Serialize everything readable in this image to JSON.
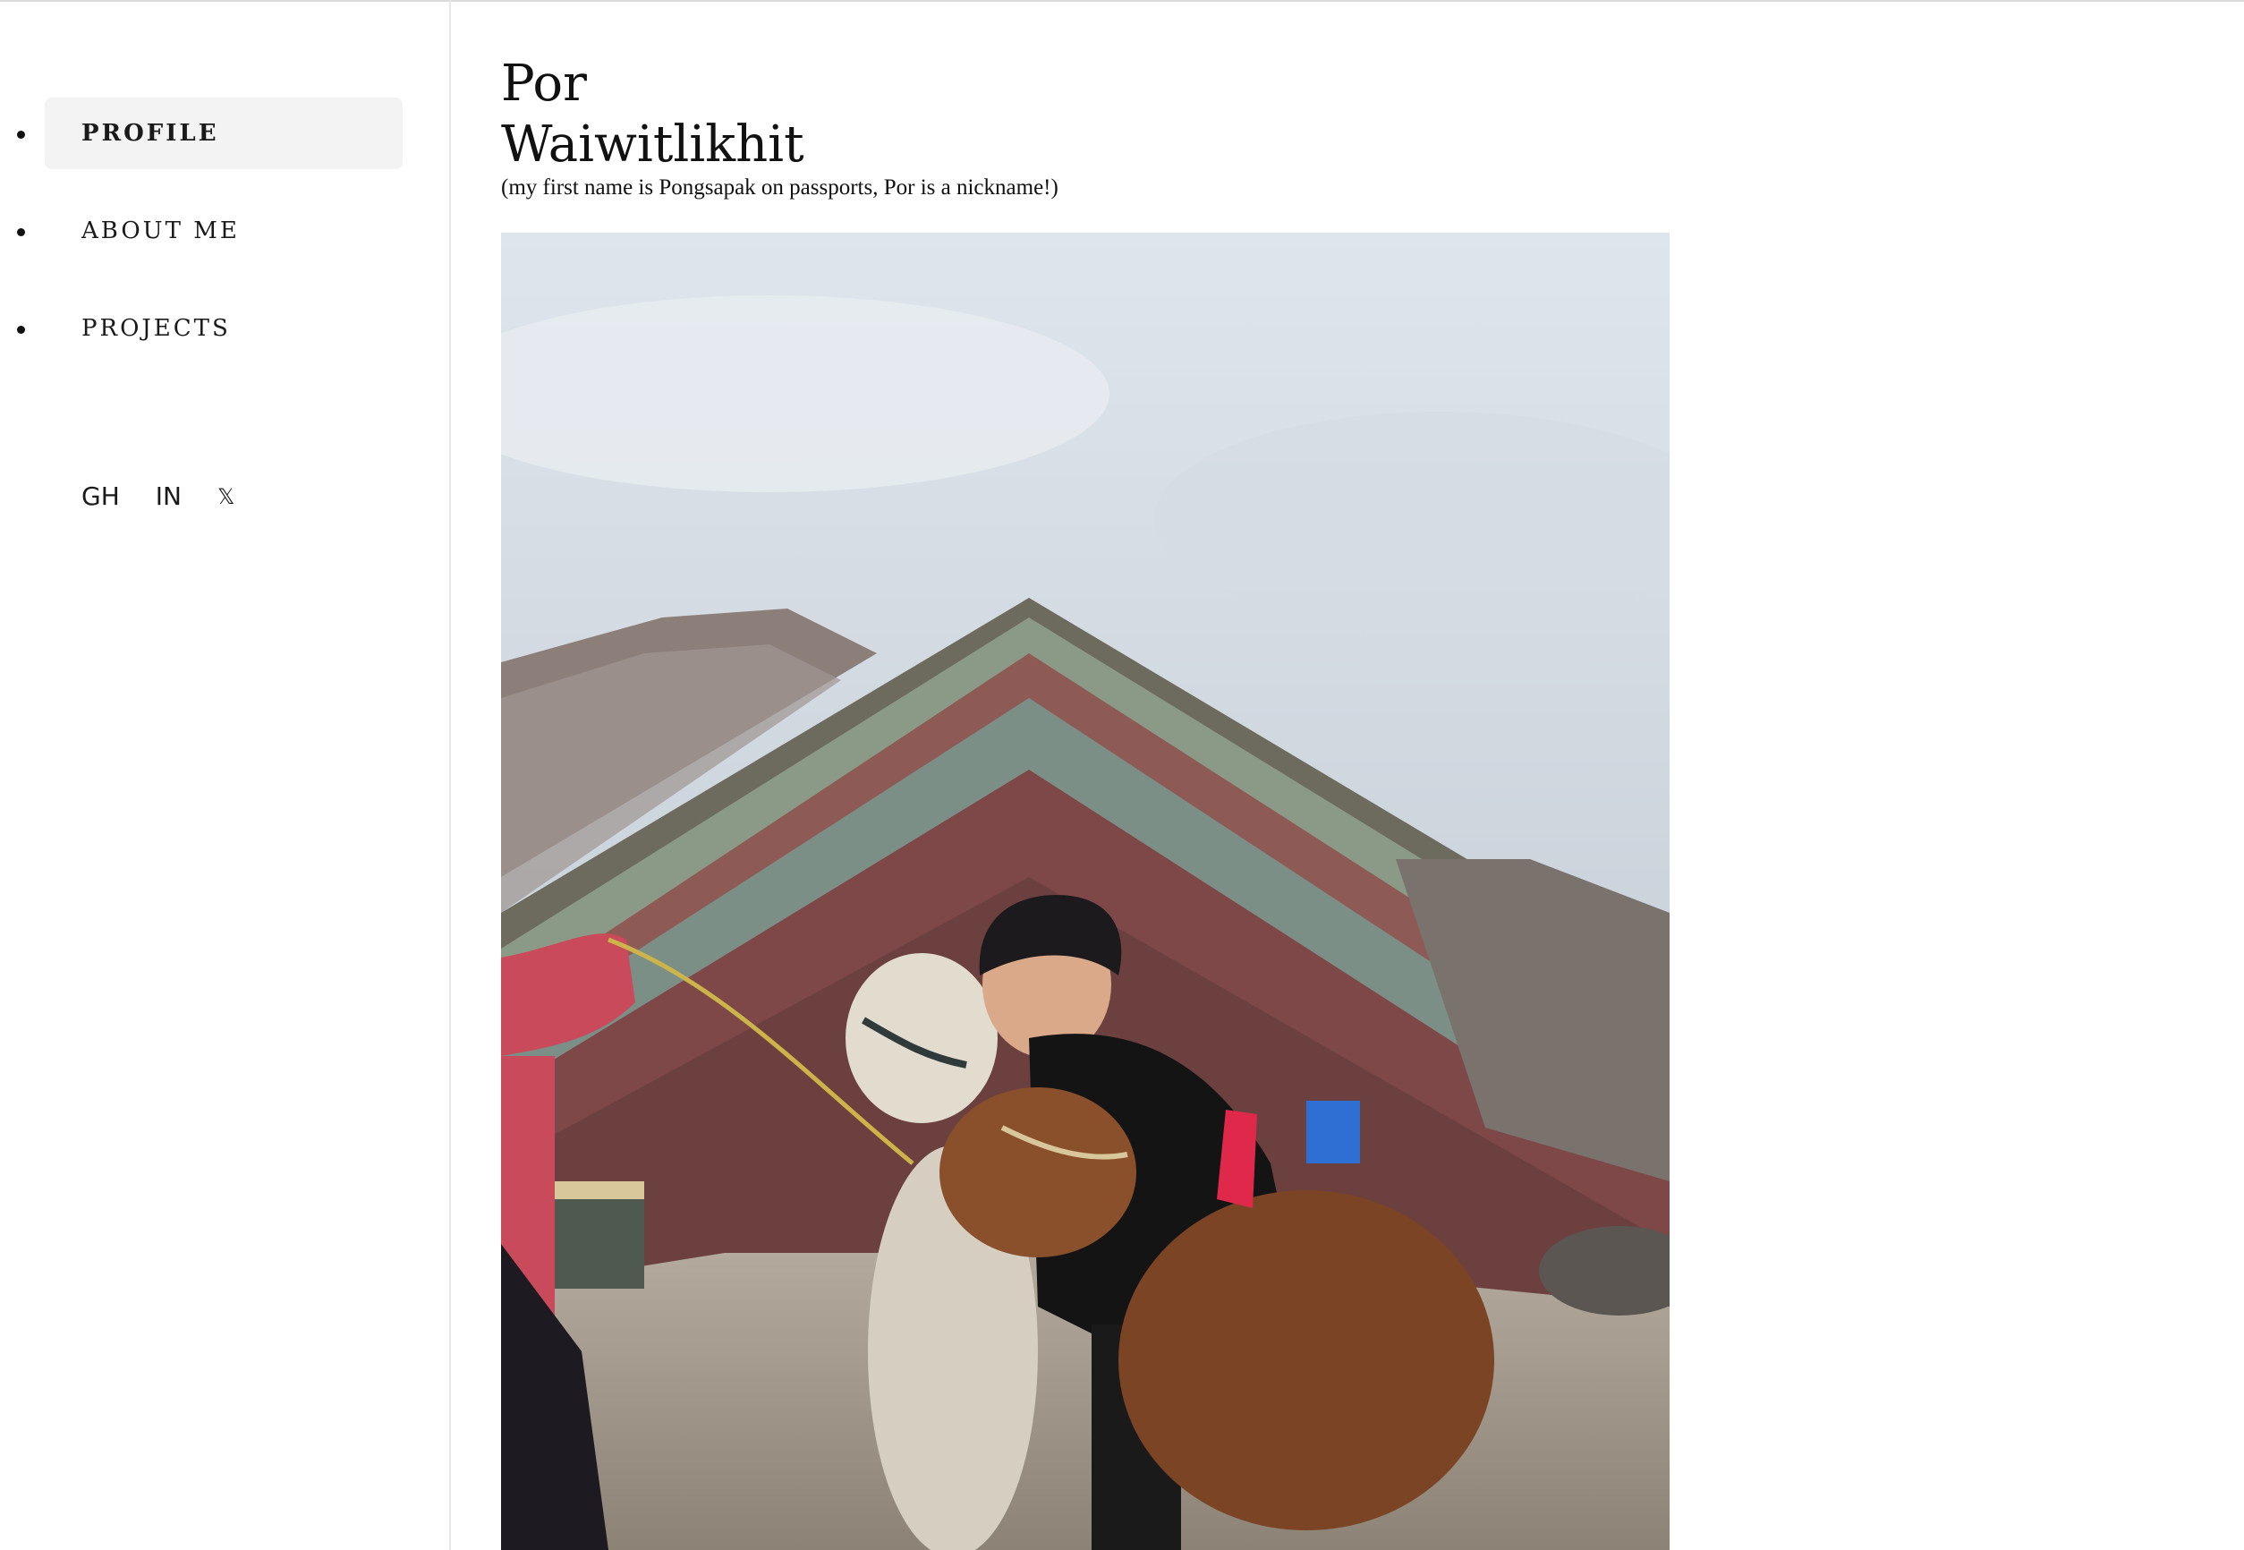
{
  "sidebar": {
    "nav": [
      {
        "label": "PROFILE",
        "active": true
      },
      {
        "label": "ABOUT ME",
        "active": false
      },
      {
        "label": "PROJECTS",
        "active": false
      }
    ],
    "socials": [
      {
        "label": "GH",
        "icon": "github-link"
      },
      {
        "label": "IN",
        "icon": "linkedin-link"
      },
      {
        "label": "𝕏",
        "icon": "x-logo-icon"
      }
    ]
  },
  "main": {
    "first_name": "Por",
    "last_name": "Waiwitlikhit",
    "subtitle": "(my first name is Pongsapak on passports, Por is a nickname!)",
    "photo": {
      "icon": "profile-photo",
      "description_colors": {
        "sky": "#c9d2dc",
        "mountain_red": "#7b4a4a",
        "mountain_green": "#7f8f86",
        "ground": "#a39a8e",
        "alpaca_white": "#d9d3c6",
        "alpaca_brown": "#6e3e22",
        "tassel": "#e0284a"
      }
    }
  },
  "theme": {
    "active_bg": "#f3f3f3",
    "divider": "#e6e6e6",
    "text": "#111111"
  }
}
